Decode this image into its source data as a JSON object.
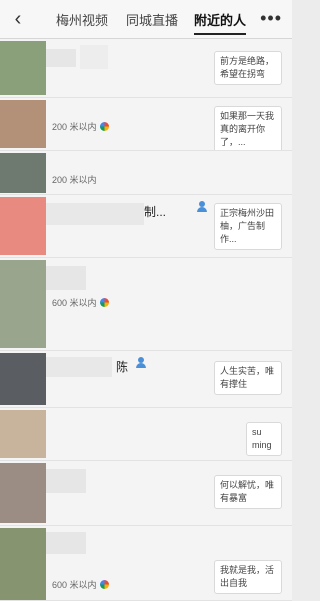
{
  "header": {
    "back_icon": "chevron-left-icon",
    "tabs": [
      {
        "label": "梅州视频"
      },
      {
        "label": "同城直播"
      },
      {
        "label": "附近的人"
      }
    ],
    "more_icon": "more-dots-icon"
  },
  "feed": {
    "items": [
      {
        "distance": "",
        "bubble": "前方是绝路，希望在拐弯",
        "name": ""
      },
      {
        "distance": "200 米以内",
        "bubble": "如果那一天我真的离开你了，...",
        "name": ""
      },
      {
        "distance": "200 米以内",
        "bubble": "",
        "name": ""
      },
      {
        "distance": "",
        "bubble": "正宗梅州沙田柚，广告制作...",
        "name": "制..."
      },
      {
        "distance": "600 米以内",
        "bubble": "",
        "name": ""
      },
      {
        "distance": "",
        "bubble": "人生实苦，唯有撑住",
        "name": "陈"
      },
      {
        "distance": "",
        "bubble": "su ming",
        "name": ""
      },
      {
        "distance": "",
        "bubble": "何以解忧，唯有暴富",
        "name": ""
      },
      {
        "distance": "600 米以内",
        "bubble": "我就是我，活出自我",
        "name": ""
      }
    ]
  }
}
